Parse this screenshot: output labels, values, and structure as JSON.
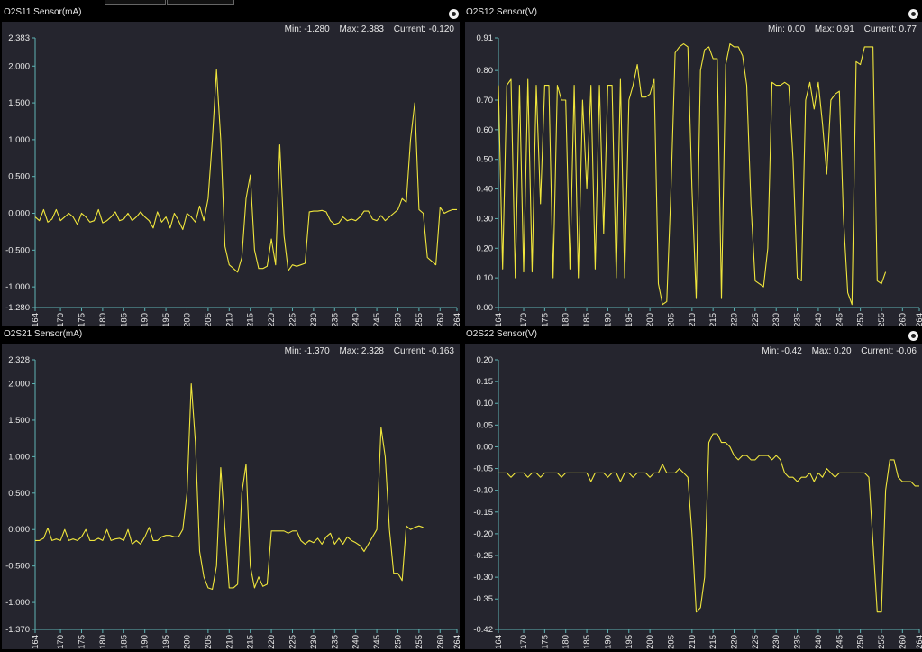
{
  "panels": [
    {
      "title": "O2S11 Sensor(mA)",
      "stats": {
        "min": "Min: -1.280",
        "max": "Max: 2.383",
        "current": "Current: -0.120"
      }
    },
    {
      "title": "O2S12 Sensor(V)",
      "stats": {
        "min": "Min: 0.00",
        "max": "Max: 0.91",
        "current": "Current: 0.77"
      }
    },
    {
      "title": "O2S21 Sensor(mA)",
      "stats": {
        "min": "Min: -1.370",
        "max": "Max: 2.328",
        "current": "Current: -0.163"
      }
    },
    {
      "title": "O2S22 Sensor(V)",
      "stats": {
        "min": "Min: -0.42",
        "max": "Max: 0.20",
        "current": "Current: -0.06"
      }
    }
  ],
  "chart_data": [
    {
      "type": "line",
      "color": "#f0e63c",
      "x_ticks": [
        "164",
        "170",
        "175",
        "180",
        "185",
        "190",
        "195",
        "200",
        "205",
        "210",
        "215",
        "220",
        "225",
        "230",
        "235",
        "240",
        "245",
        "250",
        "255",
        "260",
        "264"
      ],
      "y_ticks": [
        "2.383",
        "2.000",
        "1.500",
        "1.000",
        "0.500",
        "0.000",
        "-0.500",
        "-1.000",
        "-1.280"
      ],
      "xlim": [
        164,
        264
      ],
      "ylim": [
        -1.28,
        2.383
      ],
      "grid": false,
      "x": [
        164,
        165,
        166,
        167,
        168,
        169,
        170,
        171,
        172,
        173,
        174,
        175,
        176,
        177,
        178,
        179,
        180,
        181,
        182,
        183,
        184,
        185,
        186,
        187,
        188,
        189,
        190,
        191,
        192,
        193,
        194,
        195,
        196,
        197,
        198,
        199,
        200,
        201,
        202,
        203,
        204,
        205,
        206,
        207,
        208,
        209,
        210,
        211,
        212,
        213,
        214,
        215,
        216,
        217,
        218,
        219,
        220,
        221,
        222,
        223,
        224,
        225,
        226,
        227,
        228,
        229,
        230,
        231,
        232,
        233,
        234,
        235,
        236,
        237,
        238,
        239,
        240,
        241,
        242,
        243,
        244,
        245,
        246,
        247,
        248,
        249,
        250,
        251,
        252,
        253,
        254,
        255,
        256,
        257,
        258,
        259,
        260,
        261,
        262,
        263,
        264
      ],
      "y": [
        -0.05,
        -0.1,
        0.05,
        -0.12,
        -0.08,
        0.05,
        -0.1,
        -0.05,
        0.0,
        -0.05,
        -0.15,
        0.0,
        -0.05,
        -0.12,
        -0.1,
        0.05,
        -0.13,
        -0.1,
        -0.05,
        0.02,
        -0.1,
        -0.08,
        0.0,
        -0.1,
        -0.05,
        0.02,
        -0.05,
        -0.1,
        -0.2,
        0.02,
        -0.12,
        -0.05,
        -0.2,
        0.0,
        -0.1,
        -0.22,
        0.0,
        -0.05,
        -0.12,
        0.1,
        -0.1,
        0.2,
        1.0,
        1.95,
        1.0,
        -0.45,
        -0.7,
        -0.75,
        -0.8,
        -0.6,
        0.2,
        0.52,
        -0.5,
        -0.75,
        -0.75,
        -0.72,
        -0.35,
        -0.7,
        0.93,
        -0.3,
        -0.78,
        -0.7,
        -0.72,
        -0.7,
        -0.68,
        0.02,
        0.03,
        0.03,
        0.04,
        0.02,
        -0.1,
        -0.15,
        -0.13,
        -0.05,
        -0.1,
        -0.08,
        -0.1,
        -0.05,
        0.03,
        0.03,
        -0.08,
        -0.1,
        -0.03,
        -0.1,
        -0.05,
        0.0,
        0.05,
        0.2,
        0.15,
        1.0,
        1.5,
        0.05,
        0.0,
        -0.6,
        -0.65,
        -0.7,
        0.08,
        0.0,
        0.03,
        0.05,
        0.05
      ]
    },
    {
      "type": "line",
      "color": "#f0e63c",
      "x_ticks": [
        "164",
        "170",
        "175",
        "180",
        "185",
        "190",
        "195",
        "200",
        "205",
        "210",
        "215",
        "220",
        "225",
        "230",
        "235",
        "240",
        "245",
        "250",
        "255",
        "260",
        "264"
      ],
      "y_ticks": [
        "0.91",
        "0.80",
        "0.70",
        "0.60",
        "0.50",
        "0.40",
        "0.30",
        "0.20",
        "0.10",
        "0.00"
      ],
      "xlim": [
        164,
        264
      ],
      "ylim": [
        0.0,
        0.91
      ],
      "grid": false,
      "x": [
        164,
        165,
        166,
        167,
        168,
        169,
        170,
        171,
        172,
        173,
        174,
        175,
        176,
        177,
        178,
        179,
        180,
        181,
        182,
        183,
        184,
        185,
        186,
        187,
        188,
        189,
        190,
        191,
        192,
        193,
        194,
        195,
        196,
        197,
        198,
        199,
        200,
        201,
        202,
        203,
        204,
        205,
        206,
        207,
        208,
        209,
        210,
        211,
        212,
        213,
        214,
        215,
        216,
        217,
        218,
        219,
        220,
        221,
        222,
        223,
        224,
        225,
        226,
        227,
        228,
        229,
        230,
        231,
        232,
        233,
        234,
        235,
        236,
        237,
        238,
        239,
        240,
        241,
        242,
        243,
        244,
        245,
        246,
        247,
        248,
        249,
        250,
        251,
        252,
        253,
        254,
        255,
        256,
        257,
        258,
        259,
        260,
        261,
        262,
        263,
        264
      ],
      "y": [
        0.75,
        0.13,
        0.75,
        0.77,
        0.1,
        0.75,
        0.12,
        0.77,
        0.12,
        0.75,
        0.35,
        0.75,
        0.75,
        0.1,
        0.75,
        0.7,
        0.7,
        0.13,
        0.75,
        0.1,
        0.7,
        0.4,
        0.75,
        0.13,
        0.75,
        0.25,
        0.75,
        0.75,
        0.1,
        0.77,
        0.1,
        0.7,
        0.75,
        0.82,
        0.71,
        0.71,
        0.72,
        0.77,
        0.08,
        0.01,
        0.02,
        0.4,
        0.86,
        0.88,
        0.89,
        0.88,
        0.4,
        0.03,
        0.8,
        0.87,
        0.88,
        0.84,
        0.84,
        0.03,
        0.82,
        0.89,
        0.88,
        0.88,
        0.85,
        0.75,
        0.35,
        0.09,
        0.08,
        0.07,
        0.2,
        0.76,
        0.75,
        0.75,
        0.76,
        0.75,
        0.5,
        0.1,
        0.09,
        0.7,
        0.76,
        0.67,
        0.76,
        0.62,
        0.45,
        0.7,
        0.72,
        0.73,
        0.3,
        0.05,
        0.01,
        0.83,
        0.82,
        0.88,
        0.88,
        0.88,
        0.09,
        0.08,
        0.12
      ],
      "note": ""
    },
    {
      "type": "line",
      "color": "#f0e63c",
      "x_ticks": [
        "164",
        "170",
        "175",
        "180",
        "185",
        "190",
        "195",
        "200",
        "205",
        "210",
        "215",
        "220",
        "225",
        "230",
        "235",
        "240",
        "245",
        "250",
        "255",
        "260",
        "264"
      ],
      "y_ticks": [
        "2.328",
        "2.000",
        "1.500",
        "1.000",
        "0.500",
        "0.000",
        "-0.500",
        "-1.000",
        "-1.370"
      ],
      "xlim": [
        164,
        264
      ],
      "ylim": [
        -1.37,
        2.328
      ],
      "grid": false,
      "x": [
        164,
        165,
        166,
        167,
        168,
        169,
        170,
        171,
        172,
        173,
        174,
        175,
        176,
        177,
        178,
        179,
        180,
        181,
        182,
        183,
        184,
        185,
        186,
        187,
        188,
        189,
        190,
        191,
        192,
        193,
        194,
        195,
        196,
        197,
        198,
        199,
        200,
        201,
        202,
        203,
        204,
        205,
        206,
        207,
        208,
        209,
        210,
        211,
        212,
        213,
        214,
        215,
        216,
        217,
        218,
        219,
        220,
        221,
        222,
        223,
        224,
        225,
        226,
        227,
        228,
        229,
        230,
        231,
        232,
        233,
        234,
        235,
        236,
        237,
        238,
        239,
        240,
        241,
        242,
        243,
        244,
        245,
        246,
        247,
        248,
        249,
        250,
        251,
        252,
        253,
        254,
        255,
        256,
        257,
        258,
        259,
        260,
        261,
        262,
        263,
        264
      ],
      "y": [
        -0.15,
        -0.15,
        -0.12,
        0.02,
        -0.15,
        -0.13,
        -0.15,
        0.0,
        -0.15,
        -0.13,
        -0.15,
        -0.1,
        0.0,
        -0.15,
        -0.15,
        -0.12,
        -0.15,
        0.0,
        -0.15,
        -0.13,
        -0.12,
        -0.15,
        0.0,
        -0.2,
        -0.15,
        -0.2,
        -0.1,
        0.03,
        -0.15,
        -0.15,
        -0.1,
        -0.08,
        -0.08,
        -0.1,
        -0.1,
        0.0,
        0.5,
        2.0,
        1.2,
        -0.3,
        -0.65,
        -0.8,
        -0.82,
        -0.5,
        0.85,
        0.0,
        -0.8,
        -0.8,
        -0.75,
        0.5,
        0.9,
        -0.5,
        -0.8,
        -0.65,
        -0.78,
        -0.75,
        -0.02,
        -0.02,
        -0.02,
        -0.02,
        -0.05,
        -0.02,
        -0.02,
        -0.15,
        -0.2,
        -0.15,
        -0.18,
        -0.12,
        -0.2,
        -0.1,
        -0.05,
        -0.2,
        -0.12,
        -0.2,
        -0.1,
        -0.15,
        -0.18,
        -0.22,
        -0.3,
        -0.2,
        -0.1,
        0.0,
        1.4,
        1.0,
        0.0,
        -0.6,
        -0.6,
        -0.7,
        0.05,
        0.0,
        0.03,
        0.05,
        0.03
      ]
    },
    {
      "type": "line",
      "color": "#f0e63c",
      "x_ticks": [
        "164",
        "170",
        "175",
        "180",
        "185",
        "190",
        "195",
        "200",
        "205",
        "210",
        "215",
        "220",
        "225",
        "230",
        "235",
        "240",
        "245",
        "250",
        "255",
        "260",
        "264"
      ],
      "y_ticks": [
        "0.20",
        "0.15",
        "0.10",
        "0.05",
        "0.00",
        "-0.05",
        "-0.10",
        "-0.15",
        "-0.20",
        "-0.25",
        "-0.30",
        "-0.35",
        "-0.42"
      ],
      "xlim": [
        164,
        264
      ],
      "ylim": [
        -0.42,
        0.2
      ],
      "grid": false,
      "x": [
        164,
        165,
        166,
        167,
        168,
        169,
        170,
        171,
        172,
        173,
        174,
        175,
        176,
        177,
        178,
        179,
        180,
        181,
        182,
        183,
        184,
        185,
        186,
        187,
        188,
        189,
        190,
        191,
        192,
        193,
        194,
        195,
        196,
        197,
        198,
        199,
        200,
        201,
        202,
        203,
        204,
        205,
        206,
        207,
        208,
        209,
        210,
        211,
        212,
        213,
        214,
        215,
        216,
        217,
        218,
        219,
        220,
        221,
        222,
        223,
        224,
        225,
        226,
        227,
        228,
        229,
        230,
        231,
        232,
        233,
        234,
        235,
        236,
        237,
        238,
        239,
        240,
        241,
        242,
        243,
        244,
        245,
        246,
        247,
        248,
        249,
        250,
        251,
        252,
        253,
        254,
        255,
        256,
        257,
        258,
        259,
        260,
        261,
        262,
        263,
        264
      ],
      "y": [
        -0.06,
        -0.06,
        -0.06,
        -0.07,
        -0.06,
        -0.06,
        -0.06,
        -0.07,
        -0.06,
        -0.06,
        -0.07,
        -0.06,
        -0.06,
        -0.06,
        -0.06,
        -0.07,
        -0.06,
        -0.06,
        -0.06,
        -0.06,
        -0.06,
        -0.06,
        -0.08,
        -0.06,
        -0.06,
        -0.06,
        -0.07,
        -0.06,
        -0.06,
        -0.08,
        -0.06,
        -0.06,
        -0.07,
        -0.06,
        -0.06,
        -0.06,
        -0.07,
        -0.06,
        -0.06,
        -0.04,
        -0.06,
        -0.06,
        -0.06,
        -0.05,
        -0.06,
        -0.07,
        -0.2,
        -0.38,
        -0.37,
        -0.3,
        0.01,
        0.03,
        0.03,
        0.01,
        0.01,
        0.0,
        -0.02,
        -0.03,
        -0.02,
        -0.02,
        -0.03,
        -0.03,
        -0.02,
        -0.02,
        -0.02,
        -0.03,
        -0.02,
        -0.03,
        -0.06,
        -0.07,
        -0.07,
        -0.08,
        -0.07,
        -0.07,
        -0.06,
        -0.08,
        -0.06,
        -0.07,
        -0.05,
        -0.06,
        -0.07,
        -0.06,
        -0.06,
        -0.06,
        -0.06,
        -0.06,
        -0.06,
        -0.06,
        -0.07,
        -0.22,
        -0.38,
        -0.38,
        -0.1,
        -0.03,
        -0.03,
        -0.07,
        -0.08,
        -0.08,
        -0.08,
        -0.09,
        -0.09
      ]
    }
  ]
}
